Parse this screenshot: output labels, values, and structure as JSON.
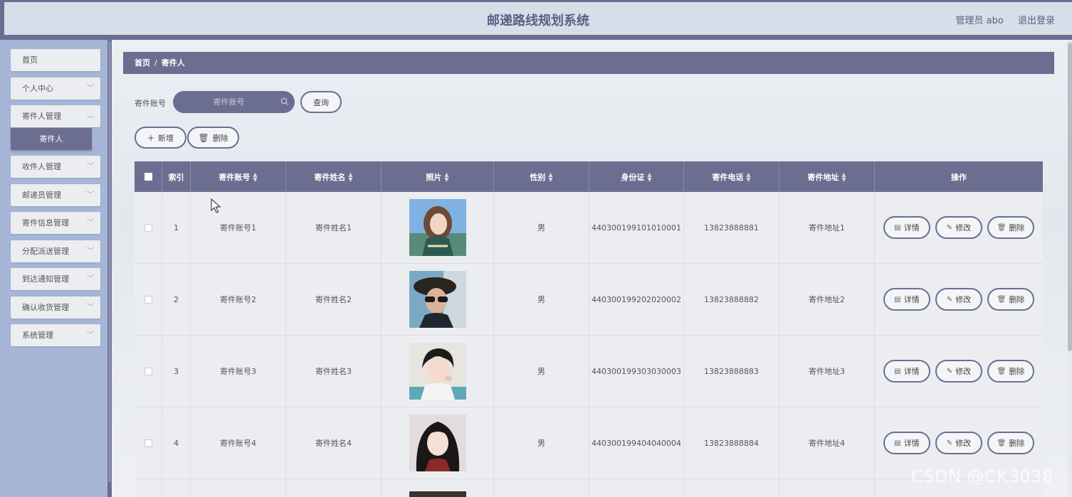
{
  "header": {
    "title": "邮递路线规划系统",
    "user": "管理员 abo",
    "logout": "退出登录"
  },
  "sidebar": {
    "items": [
      {
        "label": "首页",
        "chevron": false
      },
      {
        "label": "个人中心",
        "chevron": true
      },
      {
        "label": "寄件人管理",
        "chevron": true
      },
      {
        "label": "收件人管理",
        "chevron": true
      },
      {
        "label": "邮递员管理",
        "chevron": true
      },
      {
        "label": "寄件信息管理",
        "chevron": true
      },
      {
        "label": "分配派送管理",
        "chevron": true
      },
      {
        "label": "到达通知管理",
        "chevron": true
      },
      {
        "label": "确认收货管理",
        "chevron": true
      },
      {
        "label": "系统管理",
        "chevron": true
      }
    ],
    "active_sub": "寄件人"
  },
  "breadcrumb": {
    "home": "首页",
    "sep": "/",
    "current": "寄件人"
  },
  "search": {
    "label": "寄件账号",
    "placeholder": "寄件账号",
    "query_button": "查询"
  },
  "toolbar": {
    "add": "新增",
    "delete": "删除"
  },
  "table": {
    "headers": [
      "索引",
      "寄件账号",
      "寄件姓名",
      "照片",
      "性别",
      "身份证",
      "寄件电话",
      "寄件地址",
      "操作"
    ],
    "sortable": [
      false,
      true,
      true,
      true,
      true,
      true,
      true,
      true,
      false
    ],
    "rows": [
      {
        "index": "1",
        "account": "寄件账号1",
        "name": "寄件姓名1",
        "gender": "男",
        "id_card": "440300199101010001",
        "phone": "13823888881",
        "address": "寄件地址1"
      },
      {
        "index": "2",
        "account": "寄件账号2",
        "name": "寄件姓名2",
        "gender": "男",
        "id_card": "440300199202020002",
        "phone": "13823888882",
        "address": "寄件地址2"
      },
      {
        "index": "3",
        "account": "寄件账号3",
        "name": "寄件姓名3",
        "gender": "男",
        "id_card": "440300199303030003",
        "phone": "13823888883",
        "address": "寄件地址3"
      },
      {
        "index": "4",
        "account": "寄件账号4",
        "name": "寄件姓名4",
        "gender": "男",
        "id_card": "440300199404040004",
        "phone": "13823888884",
        "address": "寄件地址4"
      }
    ],
    "actions": {
      "detail": "详情",
      "edit": "修改",
      "delete": "删除"
    }
  },
  "watermark": "CSDN @CK3038",
  "colors": {
    "primary": "#6b6e91",
    "sidebar_bg": "#a5b6d6",
    "header_bg": "#d6dfe9"
  }
}
